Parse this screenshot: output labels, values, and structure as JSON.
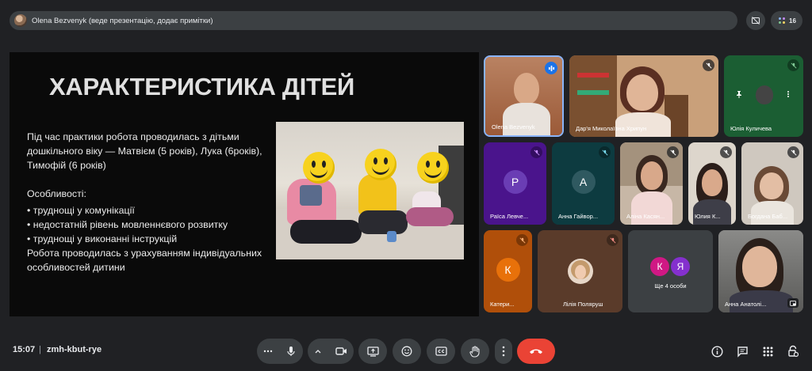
{
  "presenter_bar": {
    "text": "Olena Bezvenyk (веде презентацію, додає примітки)"
  },
  "people_count": "16",
  "slide": {
    "title": "ХАРАКТЕРИСТИКА ДІТЕЙ",
    "intro": "Під час практики робота проводилась з дітьми дошкільного віку — Матвієм (5 років), Лука (6років), Тимофій (6 років)",
    "features_title": "Особливості:",
    "bullets": [
      "• труднощі у комунікації",
      "• недостатній рівень мовленнєвого розвитку",
      "• труднощі у виконанні інструкцій"
    ],
    "closing": "Робота проводилась з урахуванням індивідуальних особливостей дитини"
  },
  "participants": [
    {
      "name": "Olena Bezvenyk",
      "speaking": true
    },
    {
      "name": "Дар'я Миколаївна Хрипун",
      "muted": true
    },
    {
      "name": "Юлія Куличева",
      "muted": true
    },
    {
      "name": "Раїса Левче...",
      "initial": "Р",
      "avatar_color": "#5c2d91",
      "muted": true
    },
    {
      "name": "Анна Гайвор...",
      "initial": "А",
      "avatar_color": "#1e4d55",
      "muted": true
    },
    {
      "name": "Аліна Касян...",
      "muted": true
    },
    {
      "name": "Юлия К...",
      "muted": true
    },
    {
      "name": "Богдана Баб...",
      "muted": true
    },
    {
      "name": "Катери...",
      "initial": "К",
      "avatar_color": "#e8710a",
      "muted": true
    },
    {
      "name": "Лілія Поляруш",
      "muted": true
    },
    {
      "name": "Ще 4 особи",
      "initials": [
        "К",
        "Я"
      ]
    },
    {
      "name": "Анна Анатолі..."
    }
  ],
  "bottom": {
    "time": "15:07",
    "separator": "|",
    "meeting_code": "zmh-kbut-rye"
  },
  "colors": {
    "end_call": "#ea4335",
    "speaking_accent": "#8ab4f8",
    "control_bg": "#3c4043"
  },
  "icons": [
    "more-options-icon",
    "mic-icon",
    "chevron-up-icon",
    "camera-icon",
    "present-icon",
    "emoji-icon",
    "captions-icon",
    "raise-hand-icon",
    "more-vert-icon",
    "end-call-icon",
    "info-icon",
    "chat-icon",
    "activities-icon",
    "host-controls-icon"
  ]
}
